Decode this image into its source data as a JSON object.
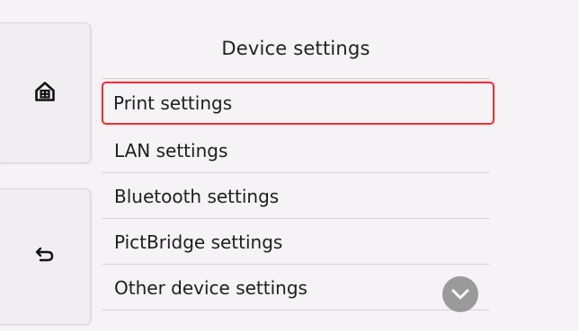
{
  "screen": {
    "title": "Device settings",
    "menu_items": [
      {
        "label": "Print settings",
        "selected": true
      },
      {
        "label": "LAN settings",
        "selected": false
      },
      {
        "label": "Bluetooth settings",
        "selected": false
      },
      {
        "label": "PictBridge settings",
        "selected": false
      },
      {
        "label": "Other device settings",
        "selected": false
      }
    ]
  },
  "side_buttons": {
    "home_icon": "home-icon",
    "back_icon": "back-arrow-icon"
  },
  "scroll": {
    "icon": "chevron-down-icon"
  },
  "colors": {
    "selection_border": "#e8333a",
    "scroll_button": "#9a9a9a",
    "background": "#f5f3f5"
  }
}
